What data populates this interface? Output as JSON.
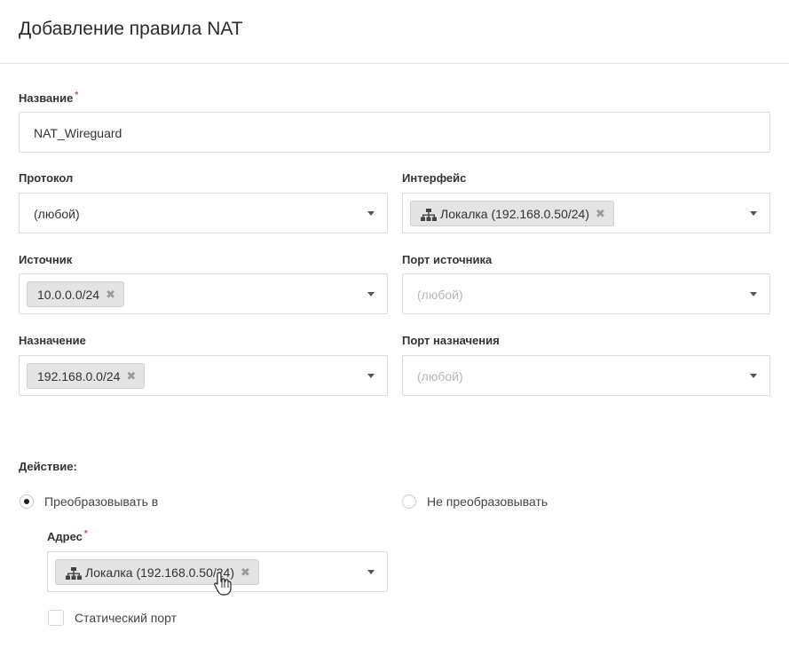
{
  "header": {
    "title": "Добавление правила NAT"
  },
  "form": {
    "name": {
      "label": "Название",
      "value": "NAT_Wireguard"
    },
    "protocol": {
      "label": "Протокол",
      "value": "(любой)"
    },
    "interface": {
      "label": "Интерфейс",
      "chip": "Локалка (192.168.0.50/24)",
      "chip_icon": "network-icon"
    },
    "source": {
      "label": "Источник",
      "chip": "10.0.0.0/24"
    },
    "source_port": {
      "label": "Порт источника",
      "placeholder": "(любой)"
    },
    "destination": {
      "label": "Назначение",
      "chip": "192.168.0.0/24"
    },
    "destination_port": {
      "label": "Порт назначения",
      "placeholder": "(любой)"
    },
    "action": {
      "label": "Действие:",
      "options": [
        {
          "label": "Преобразовывать в",
          "selected": true
        },
        {
          "label": "Не преобразовывать",
          "selected": false
        }
      ]
    },
    "address": {
      "label": "Адрес",
      "chip": "Локалка (192.168.0.50/24)",
      "chip_icon": "network-icon"
    },
    "static_port": {
      "label": "Статический порт",
      "checked": false
    }
  },
  "colors": {
    "required": "#e2403f",
    "chip_bg": "#e4e4e4",
    "border": "#dcdcdc"
  }
}
